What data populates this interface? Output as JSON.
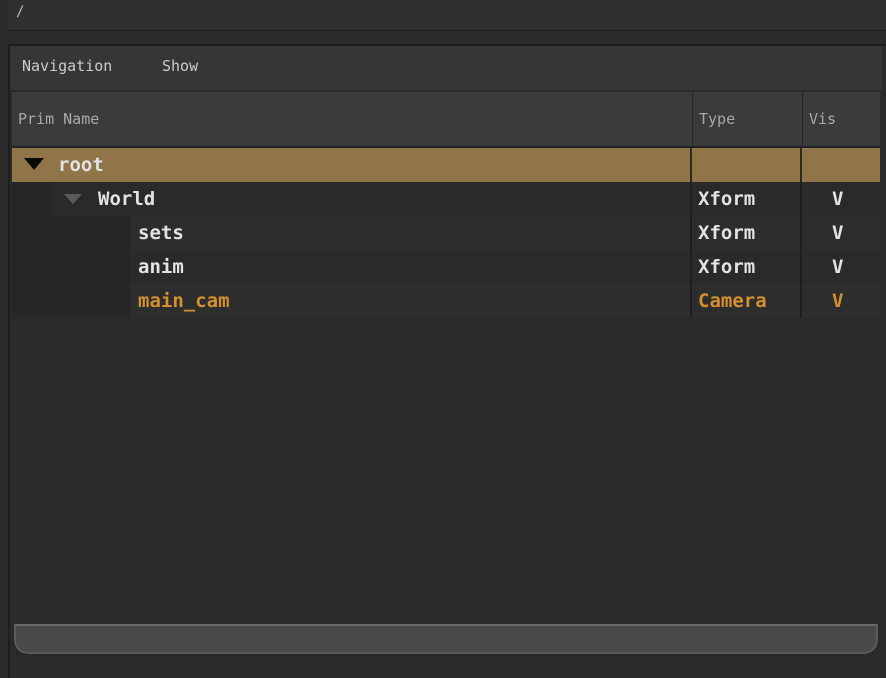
{
  "path_bar": {
    "text": "/"
  },
  "menu": {
    "items": [
      "Navigation",
      "Show"
    ]
  },
  "columns": {
    "prim_name": "Prim Name",
    "type": "Type",
    "vis": "Vis"
  },
  "rows": [
    {
      "name": "root",
      "type": "",
      "vis": "",
      "expanded": true,
      "selected": true
    },
    {
      "name": "World",
      "type": "Xform",
      "vis": "V",
      "expanded": true
    },
    {
      "name": "sets",
      "type": "Xform",
      "vis": "V"
    },
    {
      "name": "anim",
      "type": "Xform",
      "vis": "V"
    },
    {
      "name": "main_cam",
      "type": "Camera",
      "vis": "V",
      "highlight_color": "#d58f2e"
    }
  ],
  "colors": {
    "selected_row": "#8f7548",
    "camera_text": "#d58f2e",
    "background": "#2b2b2b"
  }
}
